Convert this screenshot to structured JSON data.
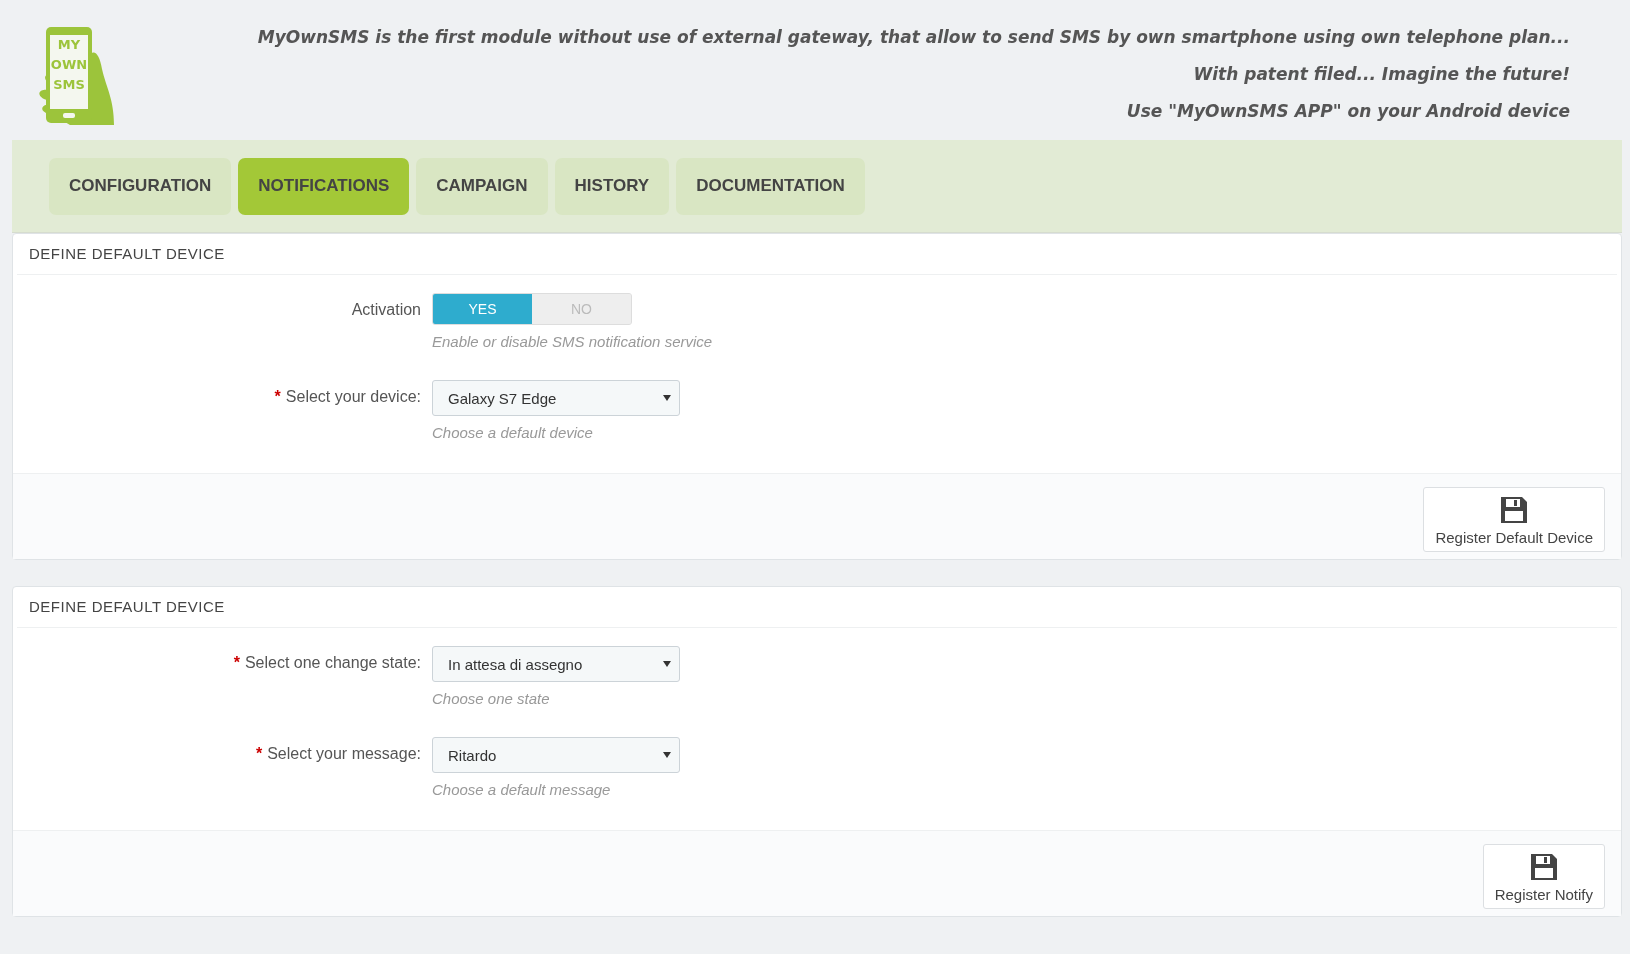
{
  "logo": {
    "lines": [
      "MY",
      "OWN",
      "SMS"
    ]
  },
  "header_lines": [
    "MyOwnSMS is the first module without use of external gateway, that allow to send SMS by own smartphone using own telephone plan...",
    "With patent filed... Imagine the future!",
    "Use \"MyOwnSMS APP\" on your Android device"
  ],
  "tabs": [
    {
      "label": "CONFIGURATION",
      "selected": false
    },
    {
      "label": "NOTIFICATIONS",
      "selected": true
    },
    {
      "label": "CAMPAIGN",
      "selected": false
    },
    {
      "label": "HISTORY",
      "selected": false
    },
    {
      "label": "DOCUMENTATION",
      "selected": false
    }
  ],
  "panels": [
    {
      "title": "DEFINE DEFAULT DEVICE",
      "fields": [
        {
          "kind": "switch",
          "label": "Activation",
          "options": [
            {
              "label": "YES",
              "selected": true
            },
            {
              "label": "NO",
              "selected": false
            }
          ],
          "help": "Enable or disable SMS notification service"
        },
        {
          "kind": "select",
          "required_mark": "*",
          "label": "Select your device:",
          "value": "Galaxy S7 Edge",
          "help": "Choose a default device"
        }
      ],
      "button": "Register Default Device"
    },
    {
      "title": "DEFINE DEFAULT DEVICE",
      "fields": [
        {
          "kind": "select",
          "required_mark": "*",
          "label": "Select one change state:",
          "value": "In attesa di assegno",
          "help": "Choose one state"
        },
        {
          "kind": "select",
          "required_mark": "*",
          "label": "Select your message:",
          "value": "Ritardo",
          "help": "Choose a default message"
        }
      ],
      "button": "Register Notify"
    }
  ]
}
